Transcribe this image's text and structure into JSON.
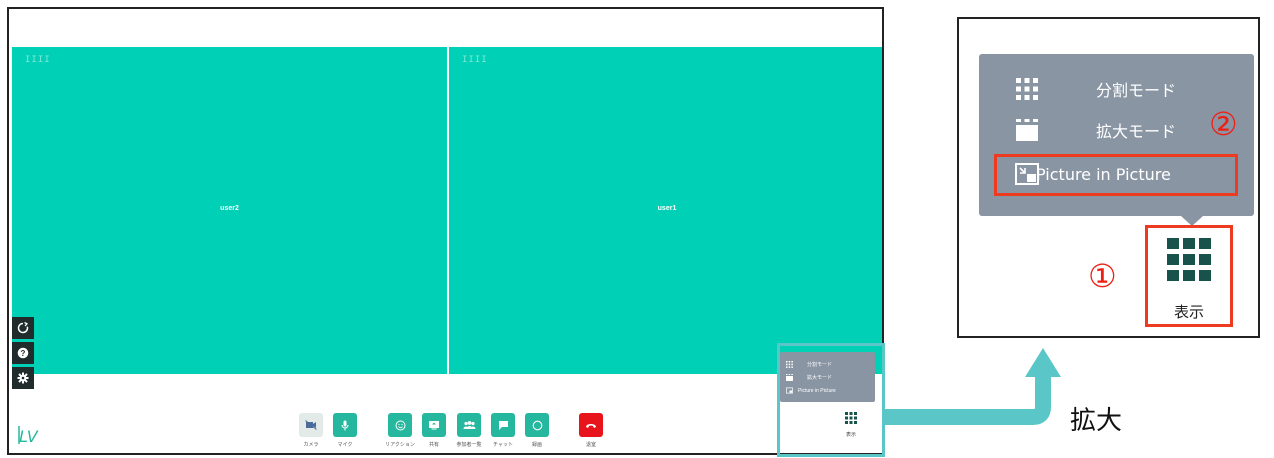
{
  "main": {
    "tiles": [
      {
        "grip": "IIII",
        "user": "user2"
      },
      {
        "grip": "IIII",
        "user": "user1"
      }
    ],
    "side_tools": [
      "refresh-icon",
      "help-icon",
      "settings-icon"
    ],
    "toolbar": {
      "buttons": [
        {
          "icon": "camera-off-icon",
          "label": "カメラ"
        },
        {
          "icon": "microphone-icon",
          "label": "マイク"
        },
        {
          "icon": "reaction-icon",
          "label": "リアクション"
        },
        {
          "icon": "share-screen-icon",
          "label": "共有"
        },
        {
          "icon": "participants-icon",
          "label": "参加者一覧"
        },
        {
          "icon": "chat-icon",
          "label": "チャット"
        },
        {
          "icon": "record-icon",
          "label": "録画"
        },
        {
          "icon": "hangup-icon",
          "label": "退室"
        }
      ]
    },
    "view_menu": {
      "items": [
        "分割モード",
        "拡大モード",
        "Picture in Picture"
      ],
      "display_label": "表示"
    }
  },
  "arrow_label": "拡大",
  "zoomed": {
    "items": [
      "分割モード",
      "拡大モード",
      "Picture in Picture"
    ],
    "display_label": "表示",
    "markers": [
      "①",
      "②"
    ]
  },
  "colors": {
    "tile": "#00d0b5",
    "button": "#25b89e",
    "hangup": "#e7141b",
    "menu": "#8a95a4",
    "highlight": "#ee3b1f",
    "arrow": "#5bc6c8"
  }
}
